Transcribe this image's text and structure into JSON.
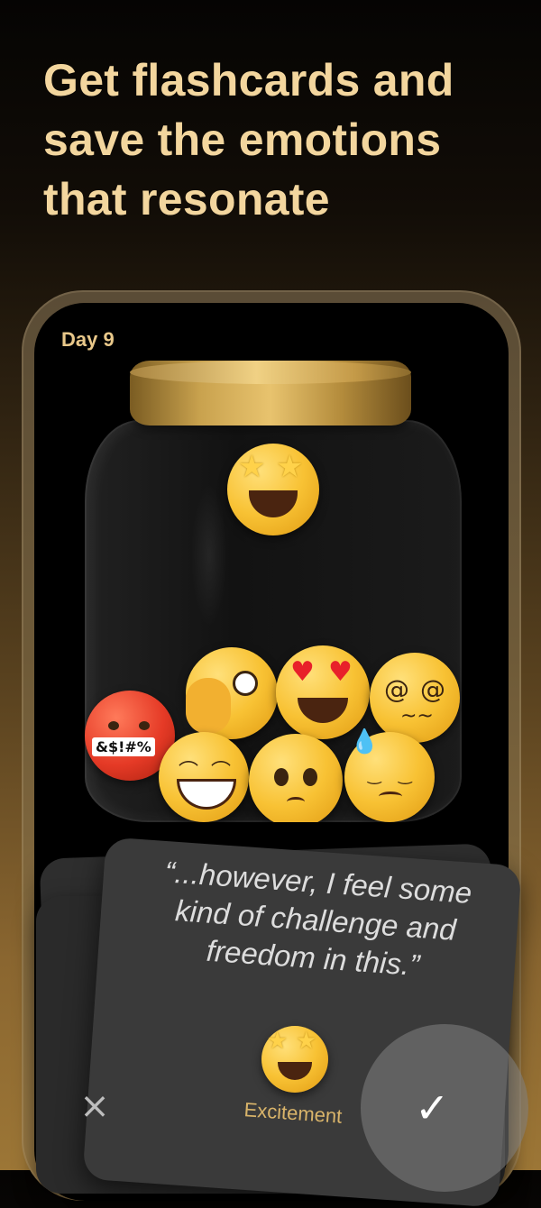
{
  "headline": {
    "line1": "Get flashcards and",
    "line2": "save the emotions",
    "line3": "that resonate"
  },
  "phone": {
    "day_label": "Day 9"
  },
  "jar": {
    "emojis": [
      "star-struck",
      "face-with-hand-over-mouth-peeking",
      "heart-eyes",
      "dizzy-face",
      "cursing-face",
      "grinning-face",
      "pleading-face",
      "downcast-sweat-face"
    ],
    "grawlix": "&$!#%"
  },
  "card": {
    "quote": "“...however, I feel some kind of challenge and freedom in this.”",
    "emotion_label": "Excitement",
    "emotion_icon": "star-struck-icon",
    "close_icon": "×",
    "confirm_icon": "✓"
  },
  "colors": {
    "accent_gold": "#f3d69e",
    "card_bg": "#3a3a3a",
    "screen_bg": "#000000"
  }
}
